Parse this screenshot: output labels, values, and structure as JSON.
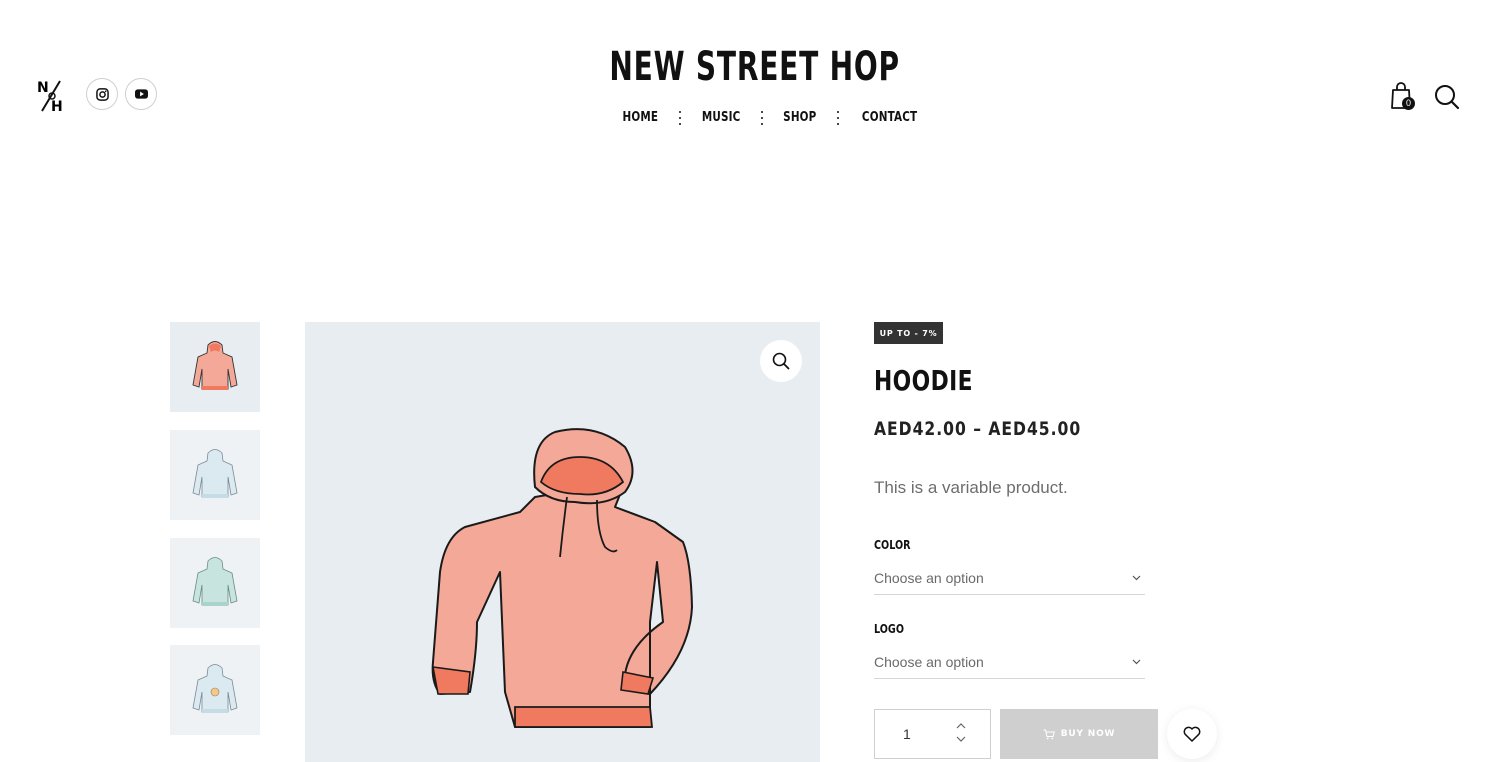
{
  "header": {
    "logo_text": "N/H",
    "brand": "NEW STREET HOP",
    "nav": [
      {
        "label": "HOME"
      },
      {
        "label": "MUSIC"
      },
      {
        "label": "SHOP"
      },
      {
        "label": "CONTACT"
      }
    ],
    "social": [
      {
        "icon": "instagram-icon"
      },
      {
        "icon": "youtube-icon"
      }
    ],
    "cart_count": "0"
  },
  "gallery": {
    "thumbnails": [
      {
        "color": "#ef8a78",
        "background": "#e8edf2"
      },
      {
        "color": "#cfe3ec",
        "background": "#eef2f5"
      },
      {
        "color": "#b9ddd7",
        "background": "#eef2f5"
      },
      {
        "color": "#cfe3ec",
        "background": "#eef2f5"
      }
    ],
    "main_background": "#e8edf2",
    "hoodie_color": "#f4a898",
    "hoodie_accent": "#f07a5f"
  },
  "product": {
    "badge": "UP TO - 7%",
    "title": "HOODIE",
    "price": "AED42.00 – AED45.00",
    "description": "This is a variable product.",
    "attributes": [
      {
        "label": "COLOR",
        "placeholder": "Choose an option"
      },
      {
        "label": "LOGO",
        "placeholder": "Choose an option"
      }
    ],
    "quantity": "1",
    "buy_label": "BUY NOW"
  },
  "colors": {
    "badge_bg": "#333333",
    "buy_disabled": "#cfcfcf",
    "text": "#111111"
  }
}
